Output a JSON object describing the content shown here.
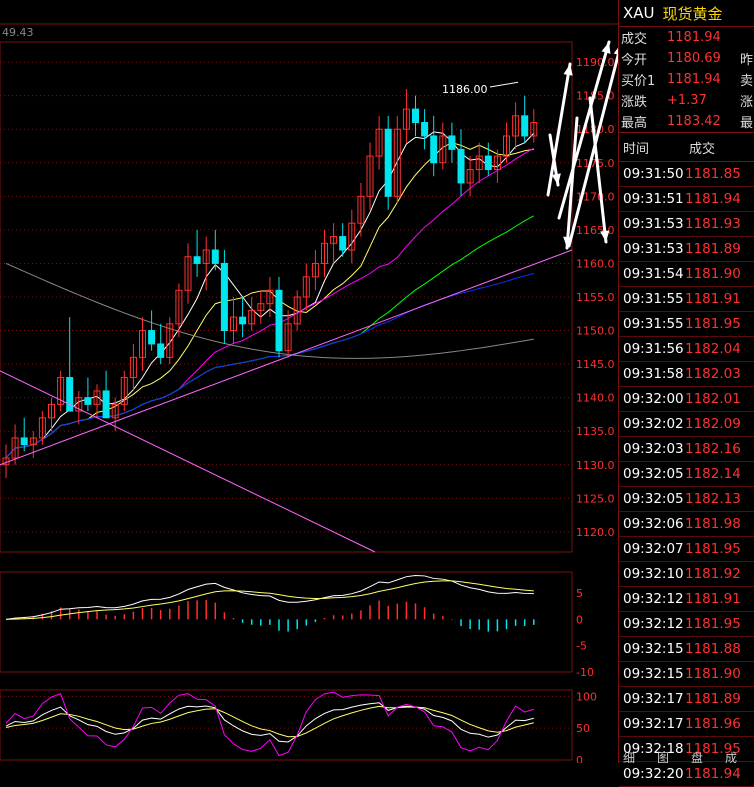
{
  "colors": {
    "up": "#ff3030",
    "down": "#00e5ee",
    "grid": "#7a1010",
    "ma5": "#ffffff",
    "ma10": "#ffff66",
    "ma20": "#ff00ff",
    "ma40": "#00ff00",
    "ma60": "#1030ff",
    "ma120": "#888888",
    "annot": "#ffffff"
  },
  "header_left": "49.43",
  "price_axis": [
    "1190.0",
    "1185.0",
    "1180.0",
    "1175.0",
    "1170.0",
    "1165.0",
    "1160.0",
    "1155.0",
    "1150.0",
    "1145.0",
    "1140.0",
    "1135.0",
    "1130.0",
    "1125.0",
    "1120.0"
  ],
  "high_label": "1186.00",
  "macd_axis": [
    "5",
    "0",
    "-5",
    "-10"
  ],
  "kdj_axis": [
    "100",
    "50",
    "0"
  ],
  "panel": {
    "symbol": "XAU",
    "name": "现货黄金",
    "quotes": [
      {
        "label": "成交",
        "value": "1181.94",
        "extra": ""
      },
      {
        "label": "今开",
        "value": "1180.69",
        "extra": "昨"
      },
      {
        "label": "买价1",
        "value": "1181.94",
        "extra": "卖"
      },
      {
        "label": "涨跌",
        "value": "+1.37",
        "extra": "涨"
      },
      {
        "label": "最高",
        "value": "1183.42",
        "extra": "最"
      }
    ],
    "ticks_header": {
      "time": "时间",
      "price": "成交"
    },
    "ticks": [
      {
        "t": "09:31:50",
        "p": "1181.85"
      },
      {
        "t": "09:31:51",
        "p": "1181.94"
      },
      {
        "t": "09:31:53",
        "p": "1181.93"
      },
      {
        "t": "09:31:53",
        "p": "1181.89"
      },
      {
        "t": "09:31:54",
        "p": "1181.90"
      },
      {
        "t": "09:31:55",
        "p": "1181.91"
      },
      {
        "t": "09:31:55",
        "p": "1181.95"
      },
      {
        "t": "09:31:56",
        "p": "1182.04"
      },
      {
        "t": "09:31:58",
        "p": "1182.03"
      },
      {
        "t": "09:32:00",
        "p": "1182.01"
      },
      {
        "t": "09:32:02",
        "p": "1182.09"
      },
      {
        "t": "09:32:03",
        "p": "1182.16"
      },
      {
        "t": "09:32:05",
        "p": "1182.14"
      },
      {
        "t": "09:32:05",
        "p": "1182.13"
      },
      {
        "t": "09:32:06",
        "p": "1181.98"
      },
      {
        "t": "09:32:07",
        "p": "1181.95"
      },
      {
        "t": "09:32:10",
        "p": "1181.92"
      },
      {
        "t": "09:32:12",
        "p": "1181.91"
      },
      {
        "t": "09:32:12",
        "p": "1181.95"
      },
      {
        "t": "09:32:15",
        "p": "1181.88"
      },
      {
        "t": "09:32:15",
        "p": "1181.90"
      },
      {
        "t": "09:32:17",
        "p": "1181.89"
      },
      {
        "t": "09:32:17",
        "p": "1181.96"
      },
      {
        "t": "09:32:18",
        "p": "1181.95"
      },
      {
        "t": "09:32:20",
        "p": "1181.94"
      }
    ],
    "tabs": [
      "细",
      "图",
      "盘",
      "成"
    ]
  },
  "chart_data": {
    "type": "candlestick",
    "ylim": [
      1117,
      1193
    ],
    "candles": [
      [
        1130,
        1133,
        1128,
        1131
      ],
      [
        1131,
        1136,
        1130,
        1134
      ],
      [
        1134,
        1137,
        1132,
        1133
      ],
      [
        1133,
        1135,
        1131,
        1134
      ],
      [
        1134,
        1138,
        1133,
        1137
      ],
      [
        1137,
        1140,
        1135,
        1139
      ],
      [
        1139,
        1144,
        1138,
        1143
      ],
      [
        1143,
        1152,
        1141,
        1138
      ],
      [
        1138,
        1141,
        1136,
        1140
      ],
      [
        1140,
        1143,
        1138,
        1139
      ],
      [
        1139,
        1142,
        1137,
        1141
      ],
      [
        1141,
        1144,
        1139,
        1137
      ],
      [
        1137,
        1140,
        1135,
        1139
      ],
      [
        1139,
        1144,
        1138,
        1143
      ],
      [
        1143,
        1148,
        1141,
        1146
      ],
      [
        1146,
        1152,
        1144,
        1150
      ],
      [
        1150,
        1153,
        1147,
        1148
      ],
      [
        1148,
        1151,
        1145,
        1146
      ],
      [
        1146,
        1152,
        1145,
        1151
      ],
      [
        1151,
        1157,
        1149,
        1156
      ],
      [
        1156,
        1163,
        1154,
        1161
      ],
      [
        1161,
        1165,
        1158,
        1160
      ],
      [
        1160,
        1164,
        1156,
        1162
      ],
      [
        1162,
        1165,
        1159,
        1160
      ],
      [
        1160,
        1162,
        1148,
        1150
      ],
      [
        1150,
        1155,
        1148,
        1152
      ],
      [
        1152,
        1155,
        1149,
        1151
      ],
      [
        1151,
        1155,
        1150,
        1153
      ],
      [
        1153,
        1156,
        1151,
        1154
      ],
      [
        1154,
        1158,
        1152,
        1156
      ],
      [
        1156,
        1158,
        1146,
        1147
      ],
      [
        1147,
        1153,
        1146,
        1151
      ],
      [
        1151,
        1156,
        1150,
        1155
      ],
      [
        1155,
        1160,
        1153,
        1158
      ],
      [
        1158,
        1162,
        1156,
        1160
      ],
      [
        1160,
        1165,
        1158,
        1163
      ],
      [
        1163,
        1166,
        1160,
        1164
      ],
      [
        1164,
        1166,
        1161,
        1162
      ],
      [
        1162,
        1168,
        1160,
        1166
      ],
      [
        1166,
        1172,
        1164,
        1170
      ],
      [
        1170,
        1178,
        1168,
        1176
      ],
      [
        1176,
        1182,
        1174,
        1180
      ],
      [
        1180,
        1182,
        1168,
        1170
      ],
      [
        1170,
        1182,
        1169,
        1180
      ],
      [
        1180,
        1186,
        1178,
        1183
      ],
      [
        1183,
        1185,
        1179,
        1181
      ],
      [
        1181,
        1183,
        1177,
        1179
      ],
      [
        1179,
        1182,
        1173,
        1175
      ],
      [
        1175,
        1181,
        1174,
        1179
      ],
      [
        1179,
        1181,
        1175,
        1177
      ],
      [
        1177,
        1180,
        1170,
        1172
      ],
      [
        1172,
        1176,
        1170,
        1174
      ],
      [
        1174,
        1178,
        1172,
        1176
      ],
      [
        1176,
        1178,
        1173,
        1174
      ],
      [
        1174,
        1177,
        1172,
        1176
      ],
      [
        1176,
        1181,
        1175,
        1179
      ],
      [
        1179,
        1184,
        1177,
        1182
      ],
      [
        1182,
        1185,
        1178,
        1179
      ],
      [
        1179,
        1183,
        1178,
        1181
      ]
    ],
    "macd_axis_range": [
      -10,
      9
    ],
    "kdj_axis_range": [
      0,
      110
    ]
  }
}
